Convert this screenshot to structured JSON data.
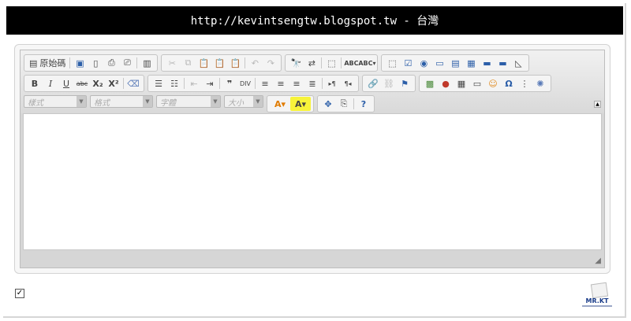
{
  "title": "http://kevintsengtw.blogspot.tw - 台灣",
  "toolbar": {
    "source_label": "原始碼",
    "style_combo": "樣式",
    "format_combo": "格式",
    "font_combo": "字體",
    "size_combo": "大小",
    "bullet_quote": "❞"
  },
  "logo": {
    "text": "MR.KT"
  },
  "checkbox": {
    "checked": true
  }
}
